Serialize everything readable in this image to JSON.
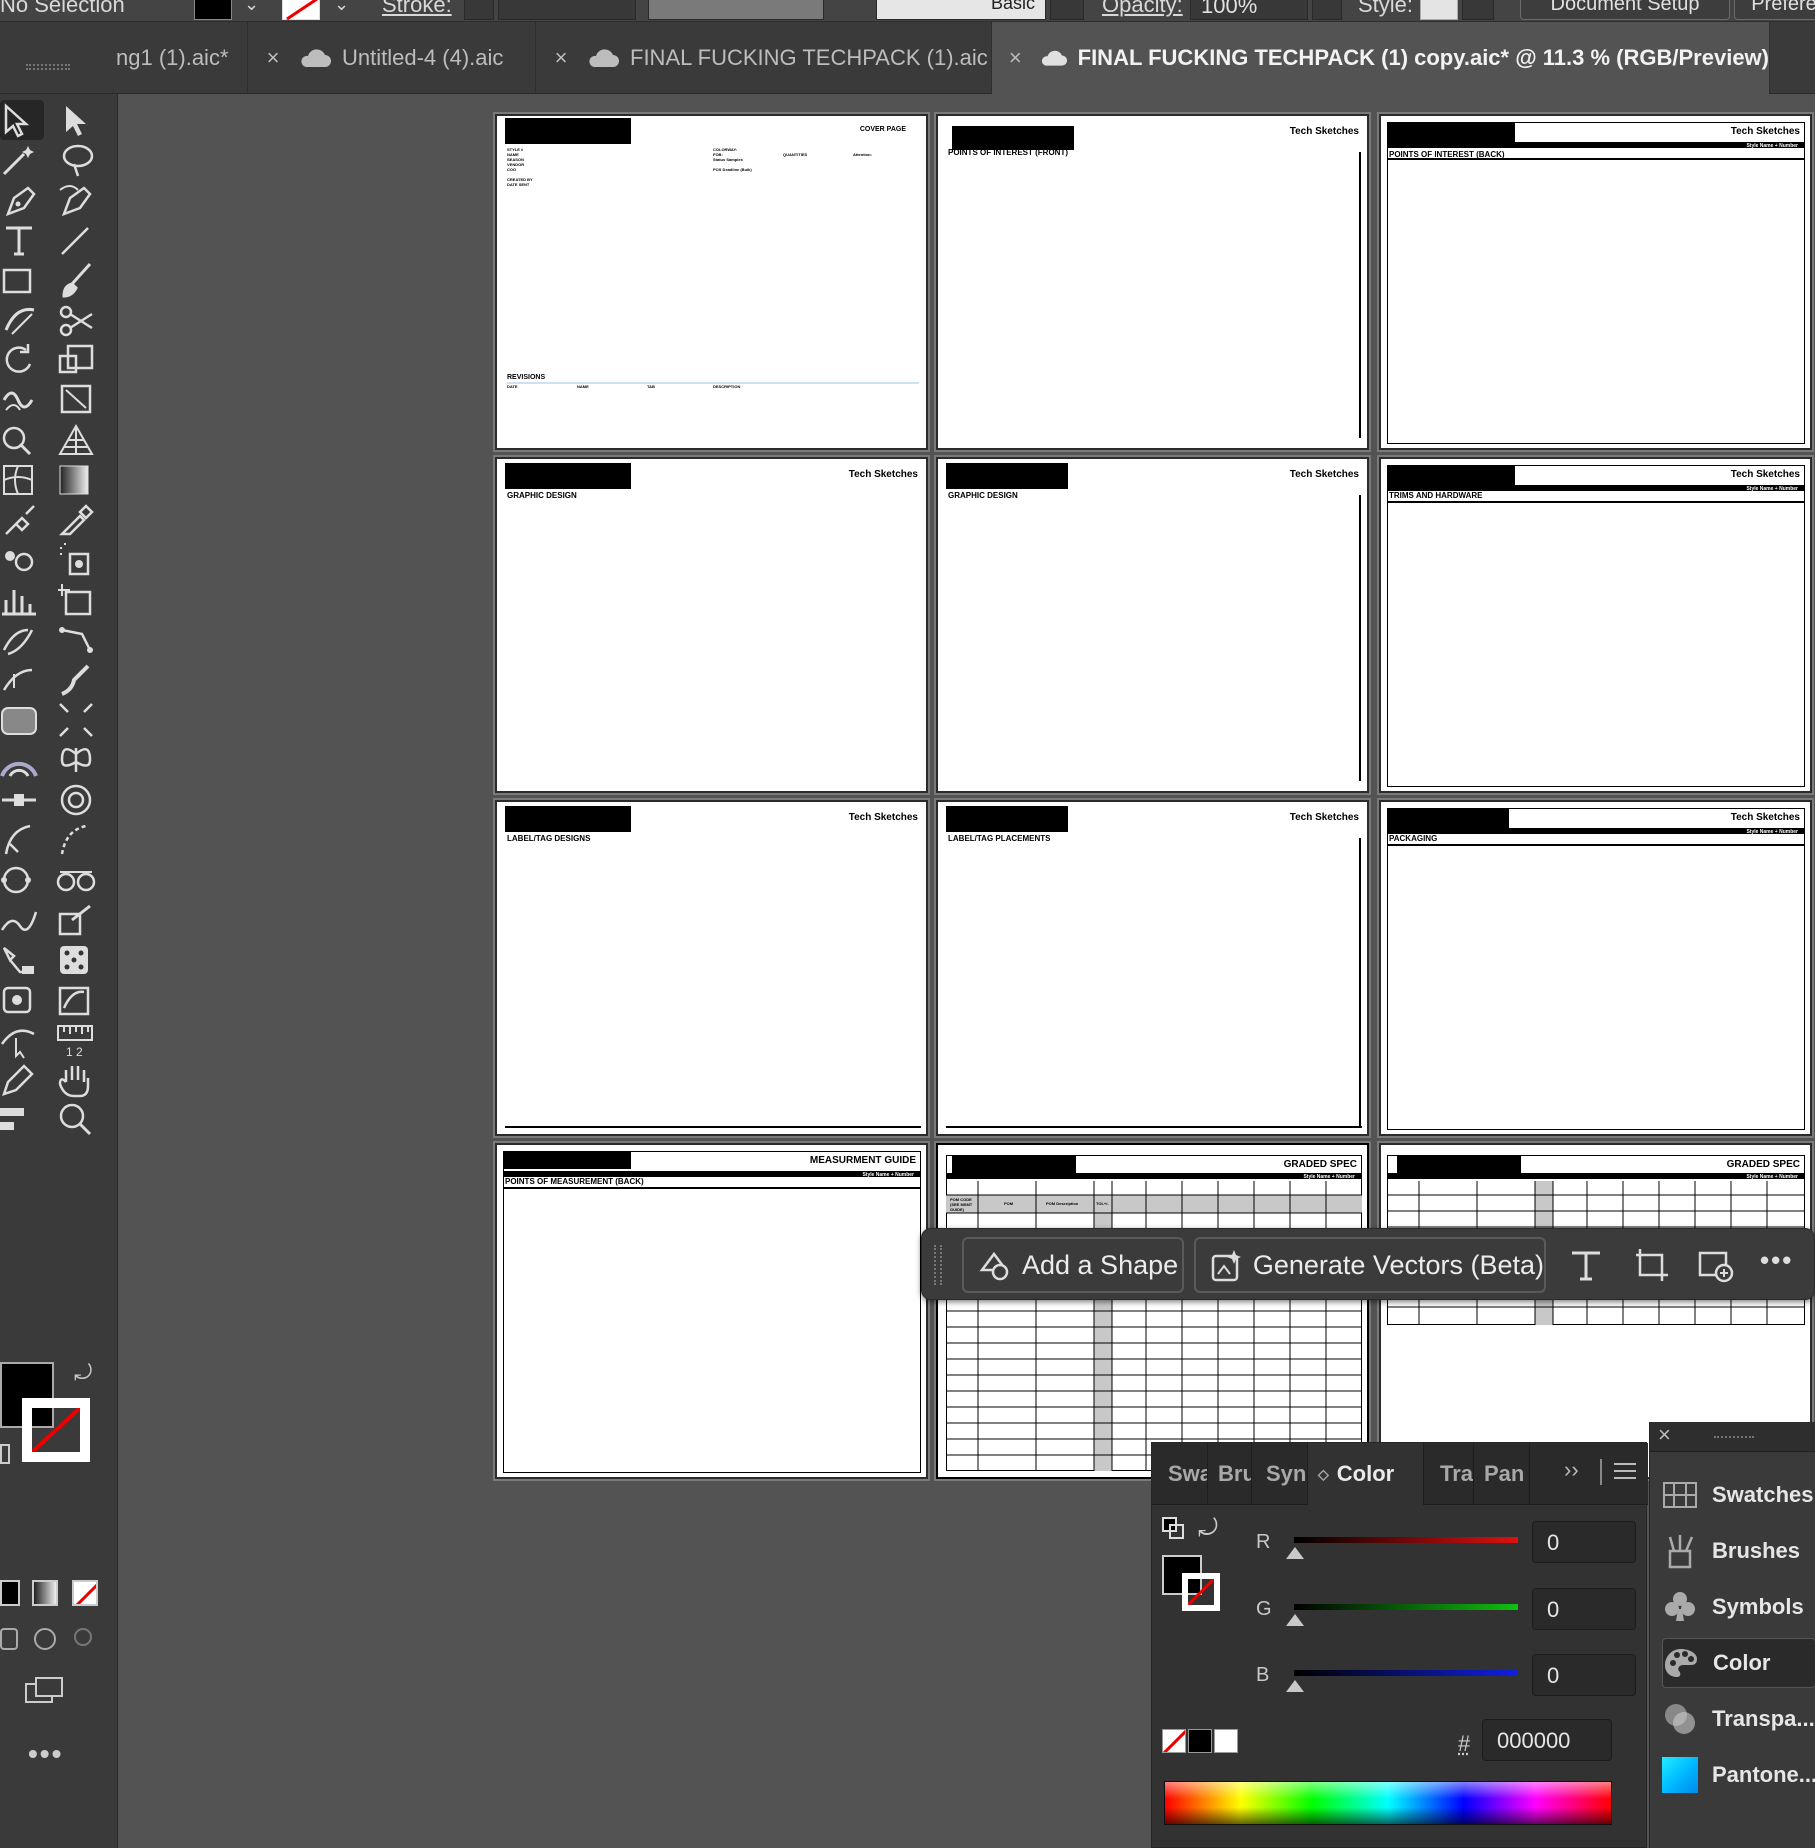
{
  "control_bar": {
    "selection_label": "No Selection",
    "stroke_label": "Stroke:",
    "brush_label": "Basic",
    "opacity_label": "Opacity:",
    "opacity_value": "100%",
    "style_label": "Style:",
    "document_setup": "Document Setup",
    "preferences": "Prefere"
  },
  "tabs": [
    {
      "label": "ng1 (1).aic*"
    },
    {
      "label": "Untitled-4 (4).aic"
    },
    {
      "label": "FINAL FUCKING TECHPACK (1).aic"
    },
    {
      "label": "FINAL FUCKING TECHPACK (1) copy.aic* @ 11.3 % (RGB/Preview)"
    }
  ],
  "artboards": {
    "cover": {
      "title": "COVER PAGE",
      "revisions": "REVISIONS",
      "fields_left": [
        "STYLE #",
        "NAME",
        "SEASON",
        "VENDOR",
        "COO",
        "",
        "CREATED BY",
        "DATE SENT"
      ],
      "fields_right": [
        "COLORWAY:",
        "FOB:",
        "Status Samples",
        "",
        "POS Deadline (Bulk)"
      ],
      "fields_mid": "QUANTITIES",
      "fields_far": "Attention:",
      "rev_cols": [
        "DATE",
        "NAME",
        "TAB",
        "DESCRIPTION"
      ]
    },
    "poi_front": {
      "title": "Tech Sketches",
      "section": "POINTS OF INTEREST (FRONT)"
    },
    "poi_back": {
      "title": "Tech Sketches",
      "sub": "Style Name + Number",
      "section": "POINTS OF INTEREST (BACK)"
    },
    "graphic1": {
      "title": "Tech Sketches",
      "section": "GRAPHIC DESIGN"
    },
    "graphic2": {
      "title": "Tech Sketches",
      "section": "GRAPHIC DESIGN"
    },
    "trims": {
      "title": "Tech Sketches",
      "sub": "Style Name + Number",
      "section": "TRIMS AND HARDWARE"
    },
    "label_designs": {
      "title": "Tech Sketches",
      "section": "LABEL/TAG DESIGNS"
    },
    "label_placements": {
      "title": "Tech Sketches",
      "section": "LABEL/TAG PLACEMENTS"
    },
    "packaging": {
      "title": "Tech Sketches",
      "sub": "Style Name + Number",
      "section": "PACKAGING"
    },
    "measurement": {
      "title": "MEASURMENT GUIDE",
      "sub": "Style Name + Number",
      "section": "POINTS OF MEASUREMENT (BACK)"
    },
    "graded1": {
      "title": "GRADED SPEC",
      "sub": "Style Name + Number",
      "cols": [
        "POM CODE (SEE MSMT GUIDE)",
        "POM",
        "POM Description",
        "TOL+/-"
      ]
    },
    "graded2": {
      "title": "GRADED SPEC",
      "sub": "Style Name + Number"
    }
  },
  "task_bar": {
    "add_shape": "Add a Shape",
    "generate_vectors": "Generate Vectors (Beta)"
  },
  "color_panel": {
    "tabs": [
      "Swa",
      "Bru",
      "Syn",
      "Color",
      "Tra",
      "Pan"
    ],
    "active_tab": "Color",
    "r_label": "R",
    "r_value": "0",
    "g_label": "G",
    "g_value": "0",
    "b_label": "B",
    "b_value": "0",
    "hash": "#",
    "hex": "000000",
    "colors": {
      "r": "#e01010",
      "g": "#10c010",
      "b": "#1020e0"
    }
  },
  "dock": {
    "items": [
      "Swatches",
      "Brushes",
      "Symbols",
      "Color",
      "Transpa...",
      "Pantone..."
    ]
  }
}
